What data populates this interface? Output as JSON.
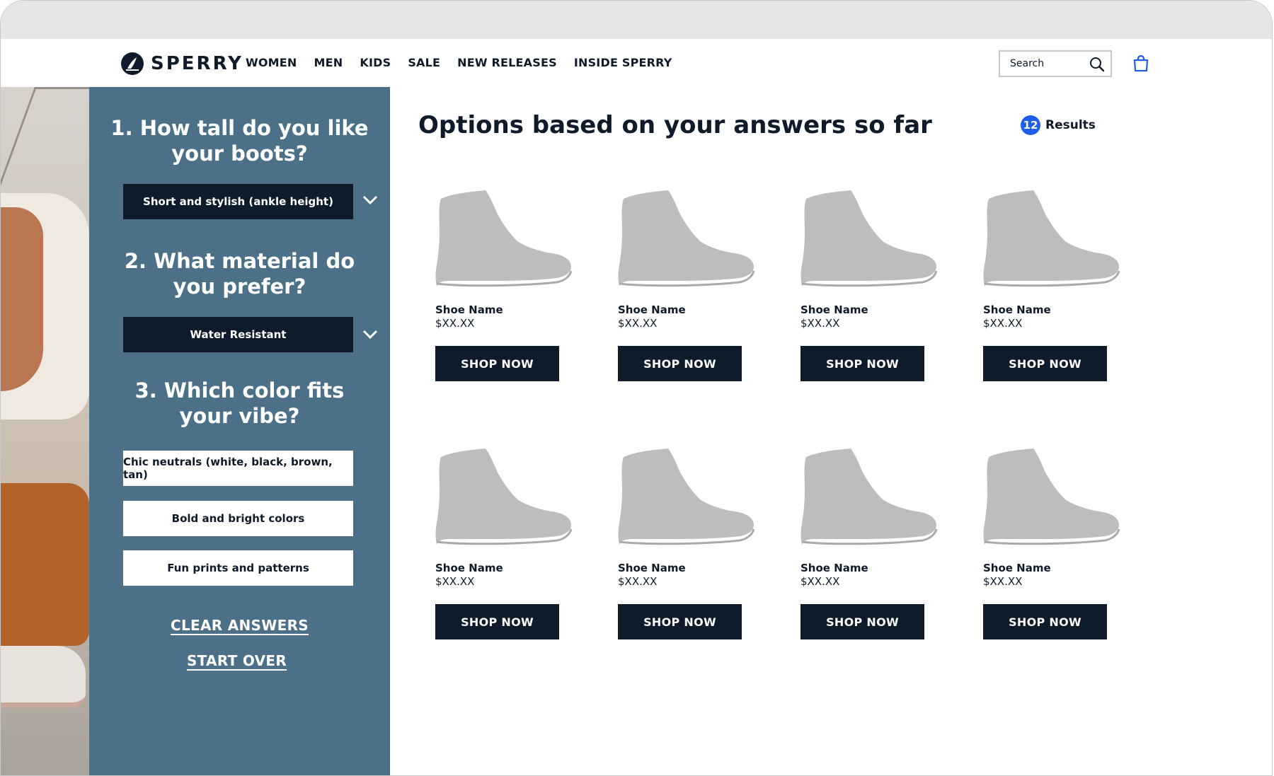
{
  "header": {
    "logo_text": "SPERRY",
    "nav": [
      "WOMEN",
      "MEN",
      "KIDS",
      "SALE",
      "NEW RELEASES",
      "INSIDE SPERRY"
    ],
    "search_placeholder": "Search",
    "icons": {
      "search": "search-icon",
      "bag": "shopping-bag-icon"
    },
    "accent_color": "#1f5ee8"
  },
  "quiz": {
    "q1": {
      "title_line1": "1. How tall do you like",
      "title_line2": "your boots?",
      "selected": "Short and stylish (ankle height)"
    },
    "q2": {
      "title_line1": "2. What material do",
      "title_line2": "you prefer?",
      "selected": "Water Resistant"
    },
    "q3": {
      "title_line1": "3. Which color fits",
      "title_line2": "your vibe?",
      "options": [
        "Chic neutrals (white, black, brown, tan)",
        "Bold and bright colors",
        "Fun prints and patterns"
      ]
    },
    "clear_label": "CLEAR ANSWERS",
    "start_over_label": "START OVER",
    "panel_color": "#4b7087"
  },
  "results": {
    "title": "Options based on your answers so far",
    "count": "12",
    "count_label": "Results",
    "products": [
      {
        "name": "Shoe Name",
        "price": "$XX.XX",
        "cta": "SHOP NOW"
      },
      {
        "name": "Shoe Name",
        "price": "$XX.XX",
        "cta": "SHOP NOW"
      },
      {
        "name": "Shoe Name",
        "price": "$XX.XX",
        "cta": "SHOP NOW"
      },
      {
        "name": "Shoe Name",
        "price": "$XX.XX",
        "cta": "SHOP NOW"
      },
      {
        "name": "Shoe Name",
        "price": "$XX.XX",
        "cta": "SHOP NOW"
      },
      {
        "name": "Shoe Name",
        "price": "$XX.XX",
        "cta": "SHOP NOW"
      },
      {
        "name": "Shoe Name",
        "price": "$XX.XX",
        "cta": "SHOP NOW"
      },
      {
        "name": "Shoe Name",
        "price": "$XX.XX",
        "cta": "SHOP NOW"
      }
    ]
  }
}
